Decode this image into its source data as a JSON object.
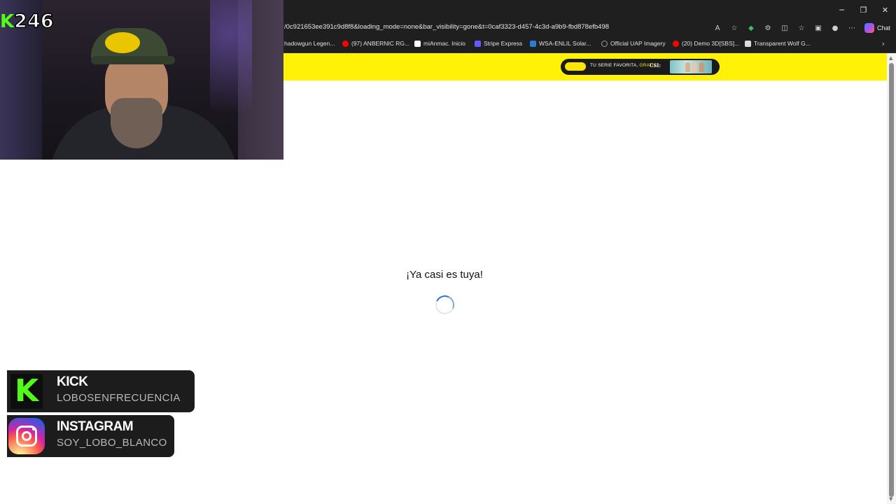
{
  "browser": {
    "url": "/0c921653ee391c9d8f8&loading_mode=none&bar_visibility=gone&t=0caf3323-d457-4c3d-a9b9-fbd878efb498",
    "chat_label": "Chat",
    "window_controls": {
      "minimize": "─",
      "restore": "❐",
      "close": "✕"
    },
    "bookmarks": [
      {
        "label": "hadowgun Legen...",
        "icon": "page-icon",
        "color": "#3a3a3a"
      },
      {
        "label": "(97) ANBERNIC RG...",
        "icon": "youtube-icon",
        "color": "#ff0000"
      },
      {
        "label": "miAnmac. Inicio",
        "icon": "r-logo-icon",
        "color": "#ffffff"
      },
      {
        "label": "Stripe Express",
        "icon": "stripe-icon",
        "color": "#635bff"
      },
      {
        "label": "WSA-ENLIL Solar...",
        "icon": "noaa-icon",
        "color": "#2b7bd6"
      },
      {
        "label": "Official UAP Imagery",
        "icon": "globe-icon",
        "color": "#9a9a9a"
      },
      {
        "label": "(20) Demo 3D[SBS]...",
        "icon": "youtube-icon",
        "color": "#ff0000"
      },
      {
        "label": "Transparent Wolf G...",
        "icon": "document-icon",
        "color": "#dddddd"
      }
    ]
  },
  "ad_banner": {
    "text": "TU SERIE FAVORITA,",
    "accent": "GRATIS",
    "brand": "CSI:",
    "background": "#fff207"
  },
  "page": {
    "loading_title": "¡Ya casi es tuya!",
    "spinner_color": "#2f6fd6"
  },
  "stream": {
    "counter_prefix": "K",
    "counter_value": "246",
    "accent_color": "#53fc18"
  },
  "socials": [
    {
      "title": "KICK",
      "handle": "LOBOSENFRECUENCIA",
      "icon": "kick-icon"
    },
    {
      "title": "INSTAGRAM",
      "handle": "SOY_LOBO_BLANCO",
      "icon": "instagram-icon"
    }
  ]
}
